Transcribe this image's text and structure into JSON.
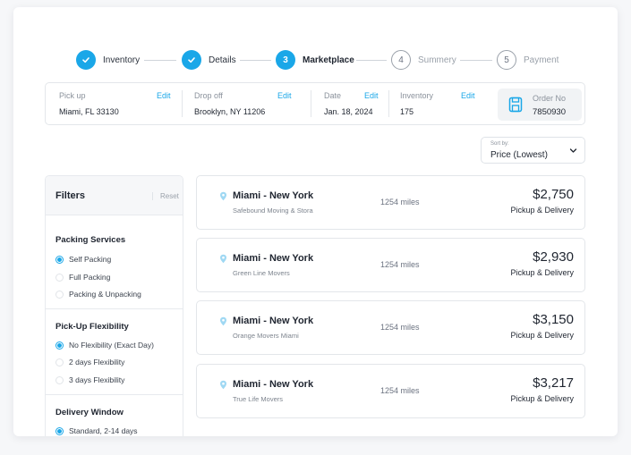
{
  "colors": {
    "accent": "#1aa7e8",
    "text": "#1f2530",
    "muted": "#9aa1aa"
  },
  "stepper": {
    "steps": [
      {
        "number": "",
        "label": "Inventory",
        "state": "done",
        "icon": "check-icon"
      },
      {
        "number": "",
        "label": "Details",
        "state": "done",
        "icon": "check-icon"
      },
      {
        "number": "3",
        "label": "Marketplace",
        "state": "active"
      },
      {
        "number": "4",
        "label": "Summery",
        "state": "todo"
      },
      {
        "number": "5",
        "label": "Payment",
        "state": "todo"
      }
    ]
  },
  "summary": {
    "pickup": {
      "label": "Pick up",
      "edit": "Edit",
      "value": "Miami, FL 33130"
    },
    "dropoff": {
      "label": "Drop off",
      "edit": "Edit",
      "value": "Brooklyn, NY 11206"
    },
    "date": {
      "label": "Date",
      "edit": "Edit",
      "value": "Jan. 18, 2024"
    },
    "inventory": {
      "label": "Inventory",
      "edit": "Edit",
      "value": "175"
    },
    "order": {
      "label": "Order No",
      "value": "7850930",
      "icon": "floppy-disk-icon"
    }
  },
  "sort": {
    "label": "Sort by:",
    "value": "Price (Lowest)"
  },
  "filters": {
    "title": "Filters",
    "reset": "Reset",
    "packing": {
      "title": "Packing Services",
      "options": [
        "Self Packing",
        "Full Packing",
        "Packing & Unpacking"
      ],
      "selected": 0
    },
    "pickup_flex": {
      "title": "Pick-Up Flexibility",
      "options": [
        "No Flexibility (Exact Day)",
        "2 days Flexibility",
        "3 days Flexibility"
      ],
      "selected": 0
    },
    "delivery": {
      "title": "Delivery Window",
      "options": [
        "Standard, 2-14 days"
      ],
      "selected": 0
    }
  },
  "results": [
    {
      "route": "Miami - New York",
      "company": "Safebound Moving & Stora",
      "distance": "1254 miles",
      "price": "$2,750",
      "service": "Pickup & Delivery"
    },
    {
      "route": "Miami - New York",
      "company": "Green Line Movers",
      "distance": "1254 miles",
      "price": "$2,930",
      "service": "Pickup & Delivery"
    },
    {
      "route": "Miami - New York",
      "company": "Orange Movers Miami",
      "distance": "1254 miles",
      "price": "$3,150",
      "service": "Pickup & Delivery"
    },
    {
      "route": "Miami - New York",
      "company": "True Life Movers",
      "distance": "1254 miles",
      "price": "$3,217",
      "service": "Pickup & Delivery"
    }
  ]
}
